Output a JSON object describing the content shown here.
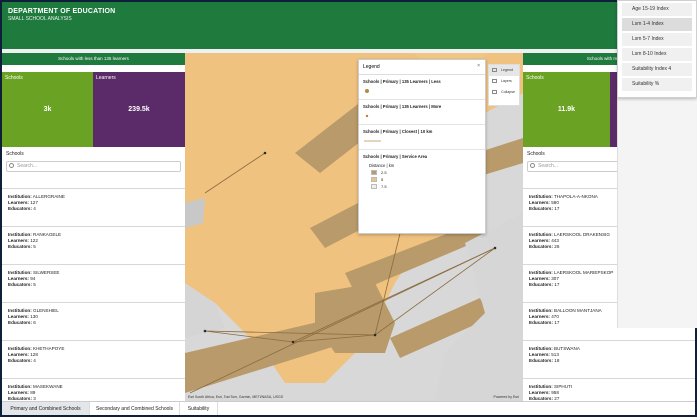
{
  "header": {
    "title": "DEPARTMENT OF EDUCATION",
    "subtitle": "SMALL SCHOOL ANALYSIS"
  },
  "left_panel": {
    "title": "Schools with less than 135 learners",
    "tiles": [
      {
        "label": "Schools",
        "value": "3k",
        "color": "#6aa323"
      },
      {
        "label": "Learners",
        "value": "239.5k",
        "color": "#5b2a68"
      }
    ],
    "list_title": "Schools",
    "search_placeholder": "Search...",
    "items": [
      {
        "institution": "ALLERGRAINE",
        "learners": "127",
        "educators": "4"
      },
      {
        "institution": "RANKAGELE",
        "learners": "122",
        "educators": "5"
      },
      {
        "institution": "SILWERSEE",
        "learners": "94",
        "educators": "5"
      },
      {
        "institution": "GLENSHIEL",
        "learners": "130",
        "educators": "6"
      },
      {
        "institution": "KHETHAPOYE",
        "learners": "128",
        "educators": "4"
      },
      {
        "institution": "MASEKWANE",
        "learners": "89",
        "educators": "3"
      }
    ]
  },
  "right_panel": {
    "title": "Schools with more tha",
    "tiles": [
      {
        "label": "Schools",
        "value": "11.9k",
        "color": "#6aa323"
      },
      {
        "label": "",
        "value": "",
        "color": "#5b2a68"
      }
    ],
    "list_title": "Schools",
    "search_placeholder": "Search...",
    "items": [
      {
        "institution": "THAPOLA-A-NKONA",
        "learners": "580",
        "educators": "17"
      },
      {
        "institution": "LAERSKOOL DRAKENSIG",
        "learners": "443",
        "educators": "26"
      },
      {
        "institution": "LAERSKOOL MARIEPSKOP",
        "learners": "307",
        "educators": "17"
      },
      {
        "institution": "BALLOON MANTJANA",
        "learners": "470",
        "educators": "17"
      },
      {
        "institution": "BUTSWANA",
        "learners": "513",
        "educators": "18"
      },
      {
        "institution": "SIPHUTI",
        "learners": "958",
        "educators": "27"
      }
    ]
  },
  "labels": {
    "institution": "Institution:",
    "learners": "Learners:",
    "educators": "Educators:"
  },
  "legend": {
    "title": "Legend",
    "close": "×",
    "sections": [
      {
        "title": "Schools | Primary | 135 Learners | Less"
      },
      {
        "title": "Schools | Primary | 135 Learners | More"
      },
      {
        "title": "Schools | Primary | Closest | 10 km"
      },
      {
        "title": "Schools | Primary | Service Area"
      }
    ],
    "distance_label": "Distance | km",
    "distance_rows": [
      {
        "label": "2.5",
        "color": "#b99a6a"
      },
      {
        "label": "5",
        "color": "#f0c27f"
      },
      {
        "label": "7.5",
        "color": "#eeeeee"
      }
    ]
  },
  "map_tools": {
    "legend": "Legend",
    "layers": "Layers",
    "collapse": "Collapse"
  },
  "map_attribution": {
    "left": "Esri South Africa, Esri, TomTom, Garmin, METI/NASA, USGS",
    "right": "Powered by Esri"
  },
  "tabs": [
    {
      "label": "Primary and Combined Schools",
      "active": true
    },
    {
      "label": "Secondary and Combined Schools",
      "active": false
    },
    {
      "label": "Suitability",
      "active": false
    }
  ],
  "dropdown": {
    "items": [
      "Age 15-19 Index",
      "Lsm 1-4 Index",
      "Lsm 5-7 Index",
      "Lsm 8-10 Index",
      "Suitability Index 4",
      "Suitability %"
    ],
    "selected": 1
  }
}
